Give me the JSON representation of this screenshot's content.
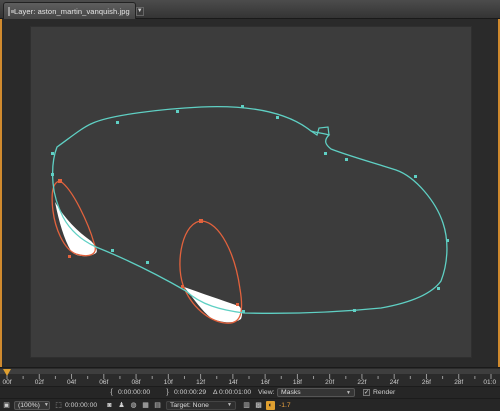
{
  "tab": {
    "title": "Layer: aston_martin_vanquish.jpg",
    "menu_icon": "dropdown-caret",
    "layer_icon": "layer-icon"
  },
  "timeline": {
    "ticks": [
      "00f",
      "02f",
      "04f",
      "06f",
      "08f",
      "10f",
      "12f",
      "14f",
      "16f",
      "18f",
      "20f",
      "22f",
      "24f",
      "26f",
      "28f",
      "01:0"
    ]
  },
  "controls": {
    "in_time": "0:00:00:00",
    "out_time": "0:00:00:29",
    "duration": "Δ 0:00:01:00",
    "view_label": "View:",
    "view_value": "Masks",
    "render_label": "Render",
    "render_checked": true,
    "zoom": "(100%)",
    "current_time": "0:00:00:00",
    "target_label": "Target: None",
    "exposure": "-1.7",
    "icons": {
      "in_bracket": "bracket-left-icon",
      "out_bracket": "bracket-right-icon",
      "snapshot": "camera-icon",
      "show_snapshot": "person-icon",
      "channel": "channel-icon",
      "region": "region-of-interest-icon",
      "transparency": "transparency-grid-icon",
      "exposure": "exposure-icon"
    }
  },
  "colors": {
    "mask_cyan": "#5fd0c4",
    "mask_orange": "#e2623d",
    "accent": "#e0a030"
  }
}
